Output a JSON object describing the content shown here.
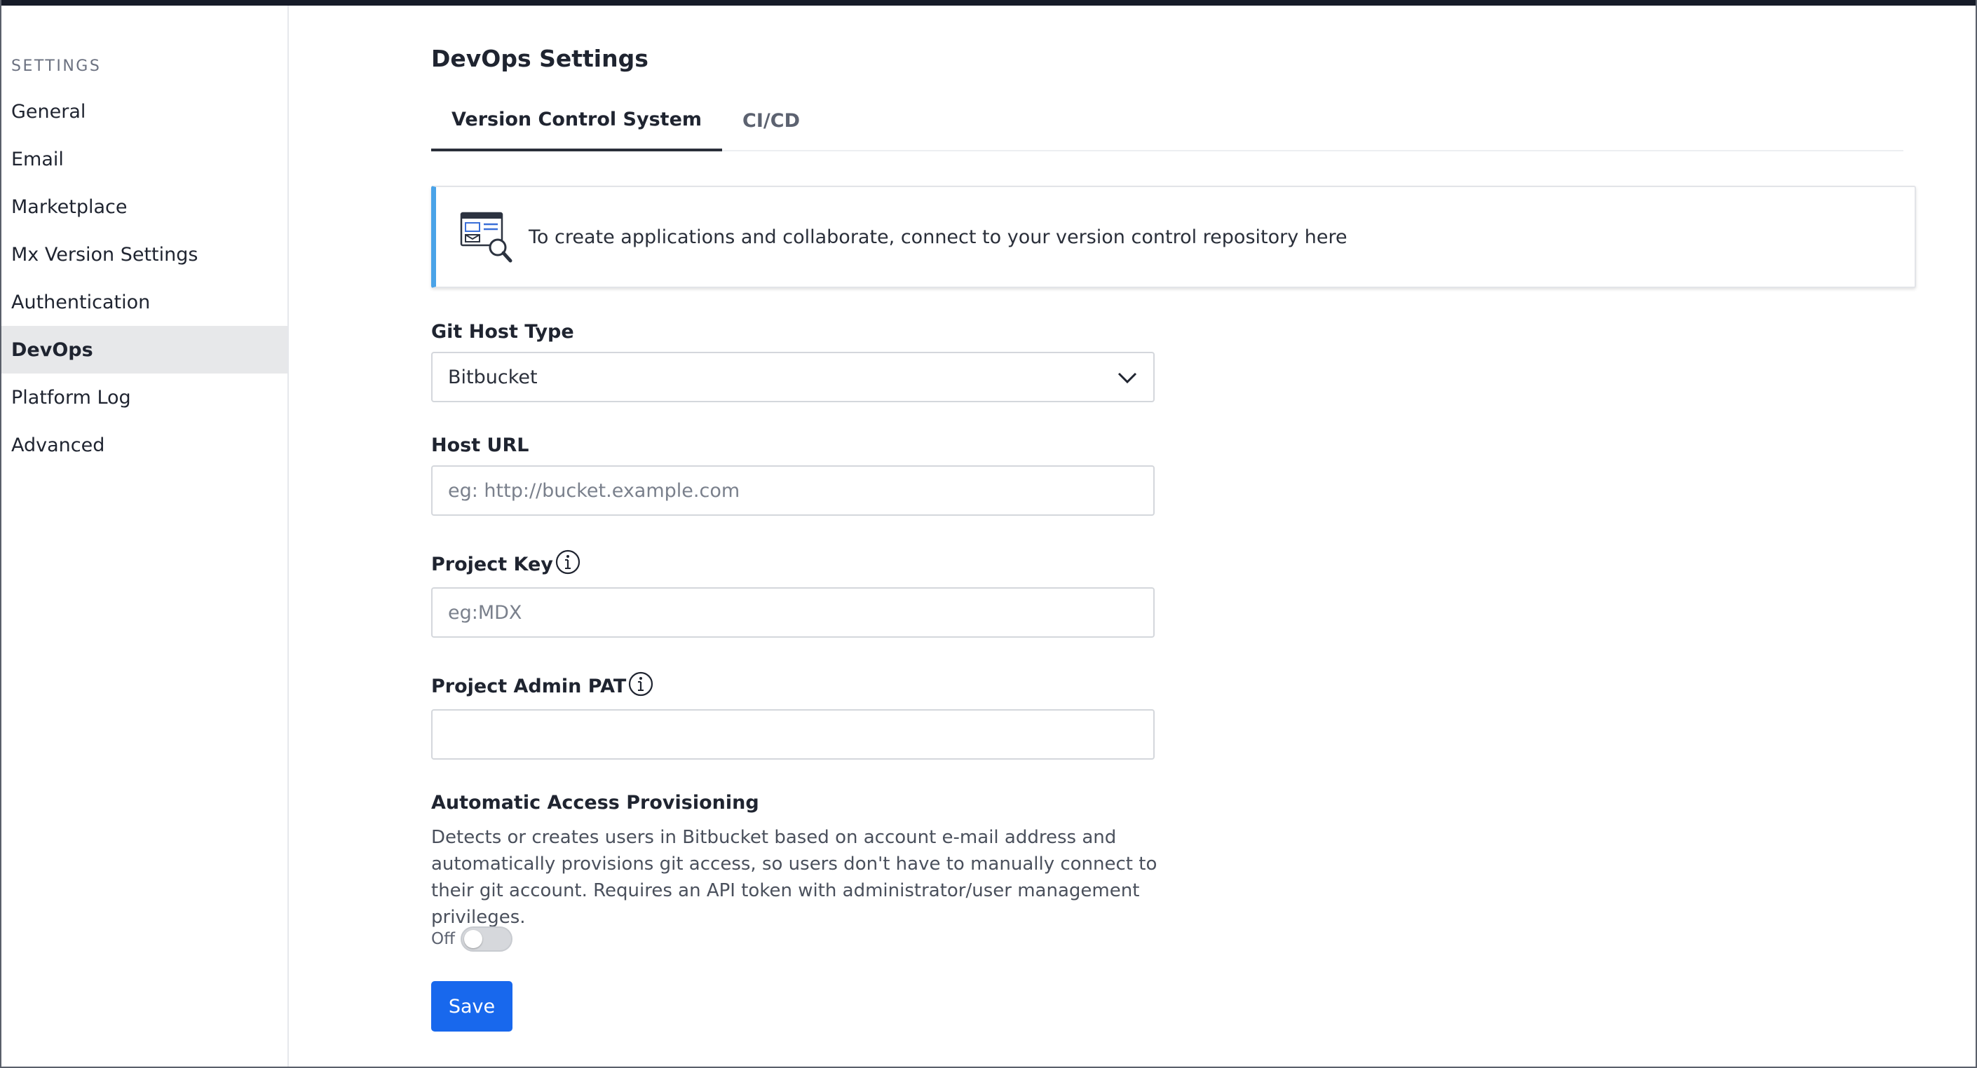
{
  "sidebar": {
    "heading": "SETTINGS",
    "items": [
      {
        "label": "General"
      },
      {
        "label": "Email"
      },
      {
        "label": "Marketplace"
      },
      {
        "label": "Mx Version Settings"
      },
      {
        "label": "Authentication"
      },
      {
        "label": "DevOps",
        "active": true
      },
      {
        "label": "Platform Log"
      },
      {
        "label": "Advanced"
      }
    ]
  },
  "main": {
    "title": "DevOps Settings",
    "tabs": [
      {
        "label": "Version Control System",
        "active": true
      },
      {
        "label": "CI/CD"
      }
    ],
    "banner": {
      "icon": "repository-search-icon",
      "text": "To create applications and collaborate, connect to your version control repository here"
    },
    "form": {
      "git_host_type": {
        "label": "Git Host Type",
        "value": "Bitbucket"
      },
      "host_url": {
        "label": "Host URL",
        "placeholder": "eg: http://bucket.example.com"
      },
      "project_key": {
        "label": "Project Key",
        "placeholder": "eg:MDX",
        "icon": "info-icon"
      },
      "project_admin_pat": {
        "label": "Project Admin PAT",
        "value": "",
        "icon": "info-icon"
      },
      "access_provisioning": {
        "label": "Automatic Access Provisioning",
        "description": "Detects or creates users in Bitbucket based on account e-mail address and automatically provisions git access, so users don't have to manually connect to their git account. Requires an API token with administrator/user management privileges.",
        "toggle_label": "Off",
        "enabled": false
      },
      "save_label": "Save"
    }
  },
  "colors": {
    "accent_blue": "#1868ed",
    "banner_border": "#4aa3e8",
    "active_sidebar_bg": "#e7e8ea"
  }
}
